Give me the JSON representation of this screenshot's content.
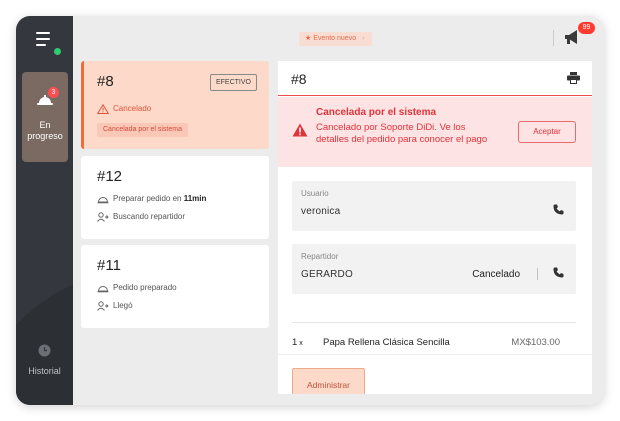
{
  "sidebar": {
    "nav_active": {
      "label": "En progreso",
      "badge": "3"
    },
    "nav_history": {
      "label": "Historial"
    }
  },
  "topbar": {
    "event_label": "Evento nuevo",
    "notification_badge": "99"
  },
  "orders": [
    {
      "number": "#8",
      "payment": "EFECTIVO",
      "status": "Cancelado",
      "chip": "Cancelada por el sistema",
      "active": true
    },
    {
      "number": "#12",
      "status_prefix": "Preparar pedido en ",
      "status_strong": "11min",
      "courier_status": "Buscando repartidor"
    },
    {
      "number": "#11",
      "status": "Pedido preparado",
      "courier_status": "Llegó"
    }
  ],
  "detail": {
    "number": "#8",
    "alert": {
      "title": "Cancelada por el sistema",
      "body": "Cancelado por Soporte DiDi. Ve los detalles del pedido para conocer el pago",
      "accept_label": "Aceptar"
    },
    "user": {
      "label": "Usuario",
      "value": "veronica"
    },
    "courier": {
      "label": "Repartidor",
      "value": "GERARDO",
      "state": "Cancelado"
    },
    "item": {
      "qty": "1",
      "qty_unit": "x",
      "name": "Papa Rellena Clásica Sencilla",
      "price": "MX$103.00"
    },
    "admin_label": "Administrar"
  },
  "colors": {
    "accent": "#f26b3a",
    "alert": "#e0333a",
    "sidebar": "#34373d"
  }
}
